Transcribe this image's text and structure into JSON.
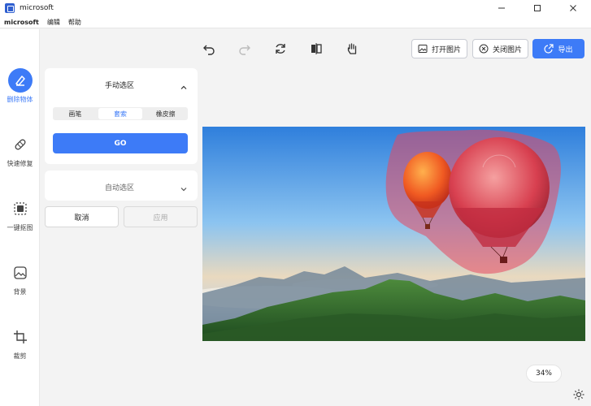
{
  "window": {
    "title": "microsoft"
  },
  "menu": {
    "brand": "microsoft",
    "items": [
      "编辑",
      "帮助"
    ]
  },
  "rail": [
    {
      "label": "删除物体",
      "icon": "eraser-icon",
      "active": true
    },
    {
      "label": "快速修复",
      "icon": "bandage-icon",
      "active": false
    },
    {
      "label": "一键抠图",
      "icon": "cutout-icon",
      "active": false
    },
    {
      "label": "背景",
      "icon": "background-icon",
      "active": false
    },
    {
      "label": "裁剪",
      "icon": "crop-icon",
      "active": false
    }
  ],
  "toolbar": {
    "undo": "undo-icon",
    "redo": "redo-icon",
    "reset": "refresh-icon",
    "compare": "compare-icon",
    "pan": "hand-icon",
    "open_label": "打开图片",
    "close_label": "关闭图片",
    "export_label": "导出"
  },
  "panel": {
    "manual_title": "手动选区",
    "tabs": [
      "画笔",
      "套索",
      "橡皮擦"
    ],
    "active_tab": "套索",
    "go_label": "GO",
    "auto_title": "自动选区",
    "cancel_label": "取消",
    "apply_label": "应用"
  },
  "zoom": {
    "value": "34%"
  },
  "colors": {
    "accent": "#3d7bf7",
    "selection": "#e8475f"
  }
}
